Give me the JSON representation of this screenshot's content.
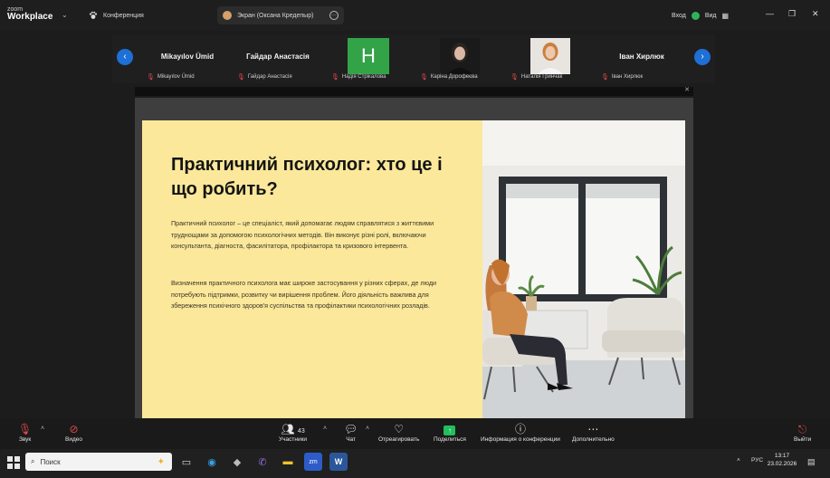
{
  "app": {
    "logo_line1": "zoom",
    "logo_line2": "Workplace"
  },
  "tabs": [
    {
      "label": "Конференция"
    },
    {
      "label": "Экран (Оксана Кредепыр)"
    }
  ],
  "header": {
    "login_label": "Вход",
    "view_label": "Вид"
  },
  "participants": [
    {
      "display": "Mikayılov Ümid",
      "label": "Mikayılov Ümid"
    },
    {
      "display": "Гайдар Анастасія",
      "label": "Гайдар Анастасія"
    },
    {
      "display": "H",
      "label": "Надія Стрікалова"
    },
    {
      "display": "",
      "label": "Каріна Дорофеєва"
    },
    {
      "display": "",
      "label": "Наталія Гринчак"
    },
    {
      "display": "Іван Хирлюк",
      "label": "Іван Хирлюк"
    }
  ],
  "slide": {
    "title": "Практичний психолог: хто це і що робить?",
    "para1": "Практичний психолог – це спеціаліст, який допомагає людям справлятися з життєвими труднощами за допомогою психологічних методів. Він виконує різні ролі, включаючи консультанта, діагноста, фасилітатора, профілактора та кризового інтервента.",
    "para2": "Визначення практичного психолога має широке застосування у різних сферах, де люди потребують підтримки, розвитку чи вирішення проблем. Його діяльність важлива для збереження психічного здоров'я суспільства та профілактики психологічних розладів."
  },
  "toolbar": {
    "audio": "Звук",
    "video": "Видео",
    "participants": "Участники",
    "participants_count": "43",
    "chat": "Чат",
    "react": "Отреагировать",
    "share": "Поделиться",
    "info": "Информация о конференции",
    "more": "Дополнительно",
    "leave": "Выйти"
  },
  "taskbar": {
    "search_placeholder": "Поиск",
    "lang": "РУС",
    "time": "13:17",
    "date": "23.02.2026"
  },
  "colors": {
    "accent": "#1e6fd6",
    "slide_bg": "#fbe89a",
    "share_green": "#22c05a"
  }
}
